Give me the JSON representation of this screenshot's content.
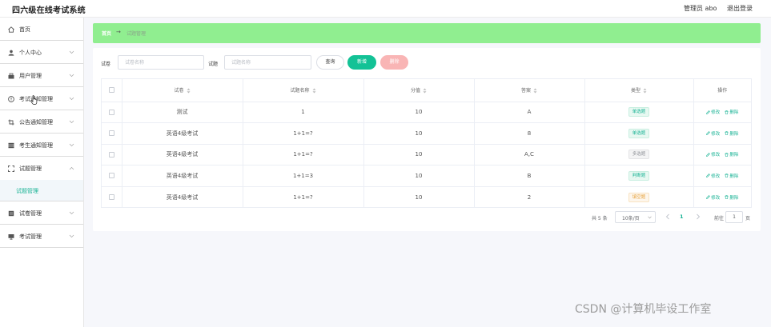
{
  "header": {
    "title": "四六级在线考试系统",
    "user": "管理员 abo",
    "logout": "退出登录"
  },
  "sidebar": {
    "items": [
      {
        "label": "首页",
        "icon": "home-icon",
        "expandable": false
      },
      {
        "label": "个人中心",
        "icon": "user-icon",
        "expandable": true
      },
      {
        "label": "用户管理",
        "icon": "users-icon",
        "expandable": true
      },
      {
        "label": "考试通知管理",
        "icon": "info-icon",
        "expandable": true
      },
      {
        "label": "公告通知管理",
        "icon": "crop-icon",
        "expandable": true
      },
      {
        "label": "考生通知管理",
        "icon": "grid-icon",
        "expandable": true
      },
      {
        "label": "试题管理",
        "icon": "scan-icon",
        "expandable": true,
        "expanded": true
      },
      {
        "label": "试卷管理",
        "icon": "doc-icon",
        "expandable": true
      },
      {
        "label": "考试管理",
        "icon": "monitor-icon",
        "expandable": true
      }
    ],
    "submenu": {
      "label": "试题管理",
      "active": true
    }
  },
  "breadcrumb": {
    "home": "首页",
    "separator": "→",
    "current": "试题管理"
  },
  "filters": {
    "paper_label": "试卷",
    "paper_placeholder": "试卷名称",
    "question_label": "试题",
    "question_placeholder": "试题名称",
    "query_button": "查询",
    "add_button": "新增",
    "delete_button": "删除"
  },
  "table": {
    "headers": [
      "试卷",
      "试题名称",
      "分值",
      "答案",
      "类型",
      "操作"
    ],
    "rows": [
      {
        "paper": "测试",
        "question": "1",
        "score": "10",
        "answer": "A",
        "type": "单选题",
        "type_style": "green"
      },
      {
        "paper": "英语4级考试",
        "question": "1+1=?",
        "score": "10",
        "answer": "8",
        "type": "单选题",
        "type_style": "green"
      },
      {
        "paper": "英语4级考试",
        "question": "1+1=?",
        "score": "10",
        "answer": "A,C",
        "type": "多选题",
        "type_style": "gray"
      },
      {
        "paper": "英语4级考试",
        "question": "1+1=3",
        "score": "10",
        "answer": "B",
        "type": "判断题",
        "type_style": "green"
      },
      {
        "paper": "英语4级考试",
        "question": "1+1=?",
        "score": "10",
        "answer": "2",
        "type": "填空题",
        "type_style": "orange"
      }
    ],
    "edit_label": "修改",
    "delete_label": "删除"
  },
  "pagination": {
    "total_text": "共 5 条",
    "page_size": "10条/页",
    "current_page": "1",
    "goto_label": "前往",
    "goto_value": "1",
    "page_suffix": "页"
  },
  "colors": {
    "accent": "#19b395",
    "breadcrumb_bg": "#90ee90",
    "add_button": "#13c296",
    "delete_button": "#f9b5b5"
  },
  "watermark": "CSDN @计算机毕设工作室"
}
